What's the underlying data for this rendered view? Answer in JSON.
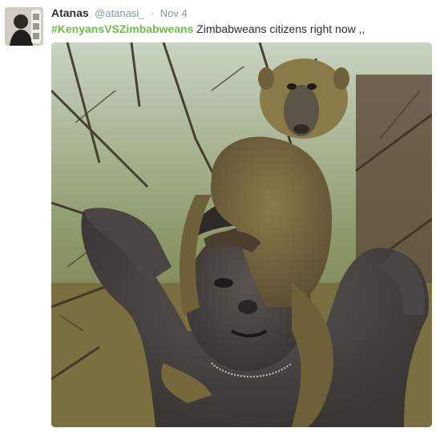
{
  "tweet": {
    "author": {
      "display_name": "Atanas",
      "screen_name": "@atanasi_",
      "avatar_icon": "user-avatar"
    },
    "separator": "·",
    "timestamp": "Nov 4",
    "hashtag": "#KenyansVSZimbabweans",
    "text": " Zimbabweans citizens right now ,,",
    "media": {
      "type": "photo",
      "icon": "photo-boy-with-baboon"
    }
  },
  "colors": {
    "hashtag": "#6ebd4a",
    "secondary_text": "#8899a6",
    "primary_text": "#292f33"
  }
}
